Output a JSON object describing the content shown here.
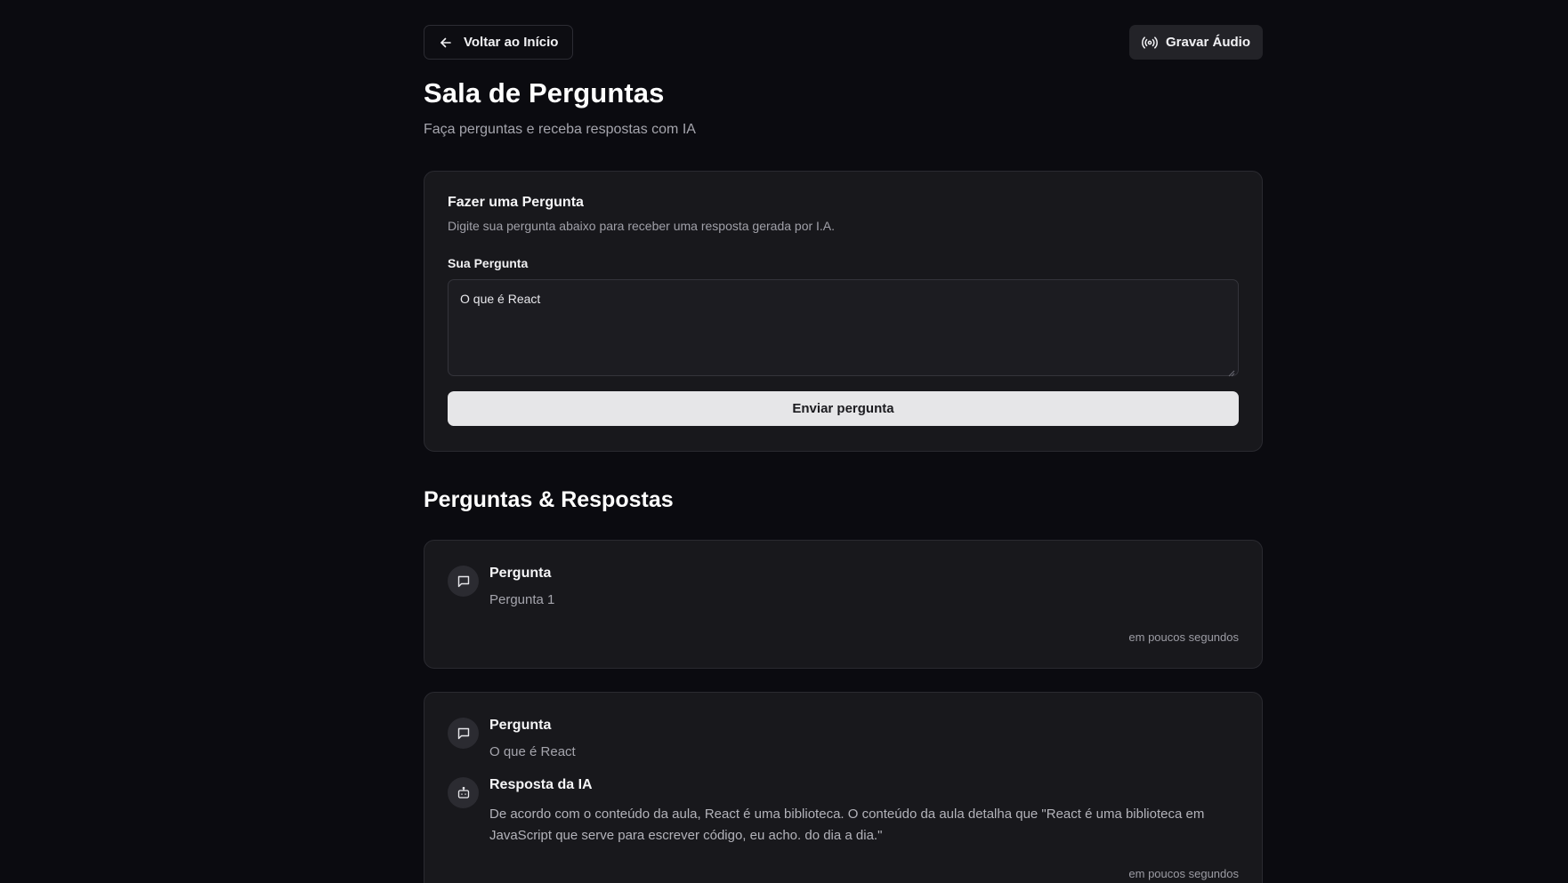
{
  "topbar": {
    "back_label": "Voltar ao Início",
    "record_label": "Gravar Áudio"
  },
  "header": {
    "title": "Sala de Perguntas",
    "subtitle": "Faça perguntas e receba respostas com IA"
  },
  "ask_form": {
    "title": "Fazer uma Pergunta",
    "description": "Digite sua pergunta abaixo para receber uma resposta gerada por I.A.",
    "field_label": "Sua Pergunta",
    "field_value": "O que é React",
    "submit_label": "Enviar pergunta"
  },
  "qa_section": {
    "title": "Perguntas & Respostas",
    "items": [
      {
        "question_heading": "Pergunta",
        "question_text": "Pergunta 1",
        "timestamp": "em poucos segundos"
      },
      {
        "question_heading": "Pergunta",
        "question_text": "O que é React",
        "answer_heading": "Resposta da IA",
        "answer_text": "De acordo com o conteúdo da aula, React é uma biblioteca. O conteúdo da aula detalha que \"React é uma biblioteca em JavaScript que serve para escrever código, eu acho. do dia a dia.\"",
        "timestamp": "em poucos segundos"
      }
    ]
  },
  "icons": {
    "back": "arrow-left-icon",
    "record": "radio-broadcast-icon",
    "question": "message-square-icon",
    "answer": "bot-icon"
  },
  "colors": {
    "background": "#0b0b10",
    "card": "#18181c",
    "primary_button": "#e6e6e8"
  }
}
